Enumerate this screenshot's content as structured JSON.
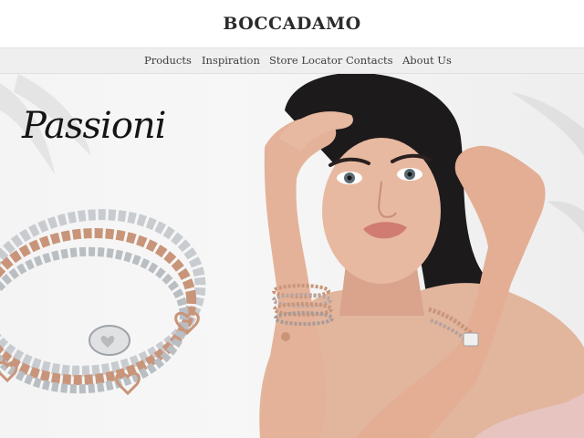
{
  "brand": {
    "logo_text": "BOCCADAMO"
  },
  "nav": {
    "items": [
      {
        "label": "Products"
      },
      {
        "label": "Inspiration"
      },
      {
        "label": "Store Locator"
      },
      {
        "label": "Contacts"
      },
      {
        "label": "About Us"
      }
    ]
  },
  "hero": {
    "title": "Passioni",
    "colors": {
      "rose_gold": "#c9957a",
      "silver": "#c8ccd0",
      "background": "#f4f4f4",
      "text": "#151515"
    },
    "image": "model-wearing-bracelets"
  }
}
